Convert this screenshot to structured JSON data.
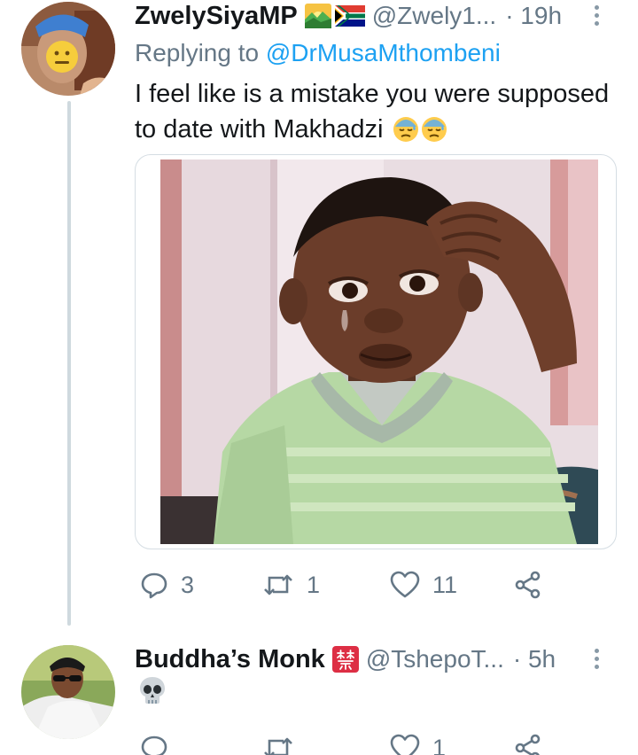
{
  "colors": {
    "link": "#1da1f2",
    "muted": "#657786",
    "text": "#14171a",
    "thread_line": "#cfd9de"
  },
  "tweets": [
    {
      "name": "ZwelySiyaMP",
      "badges": [
        "sunrise-emoji",
        "south-africa-flag-emoji"
      ],
      "handle": "@Zwely1...",
      "time": "· 19h",
      "replying_prefix": "Replying to ",
      "replying_to": "@DrMusaMthombeni",
      "text": "I feel like is a mistake you were supposed to date with Makhadzi",
      "text_emojis": [
        "downcast-face-with-sweat-emoji",
        "downcast-face-with-sweat-emoji"
      ],
      "media": "photo-crying-child-meme",
      "stats": {
        "replies": "3",
        "retweets": "1",
        "likes": "11"
      }
    },
    {
      "name": "Buddha’s Monk",
      "badges": [
        "prohibited-kanji-emoji"
      ],
      "handle": "@TshepoT...",
      "time": "· 5h",
      "text_emojis": [
        "skull-emoji"
      ],
      "stats": {
        "replies": "",
        "retweets": "",
        "likes": "1"
      }
    }
  ]
}
